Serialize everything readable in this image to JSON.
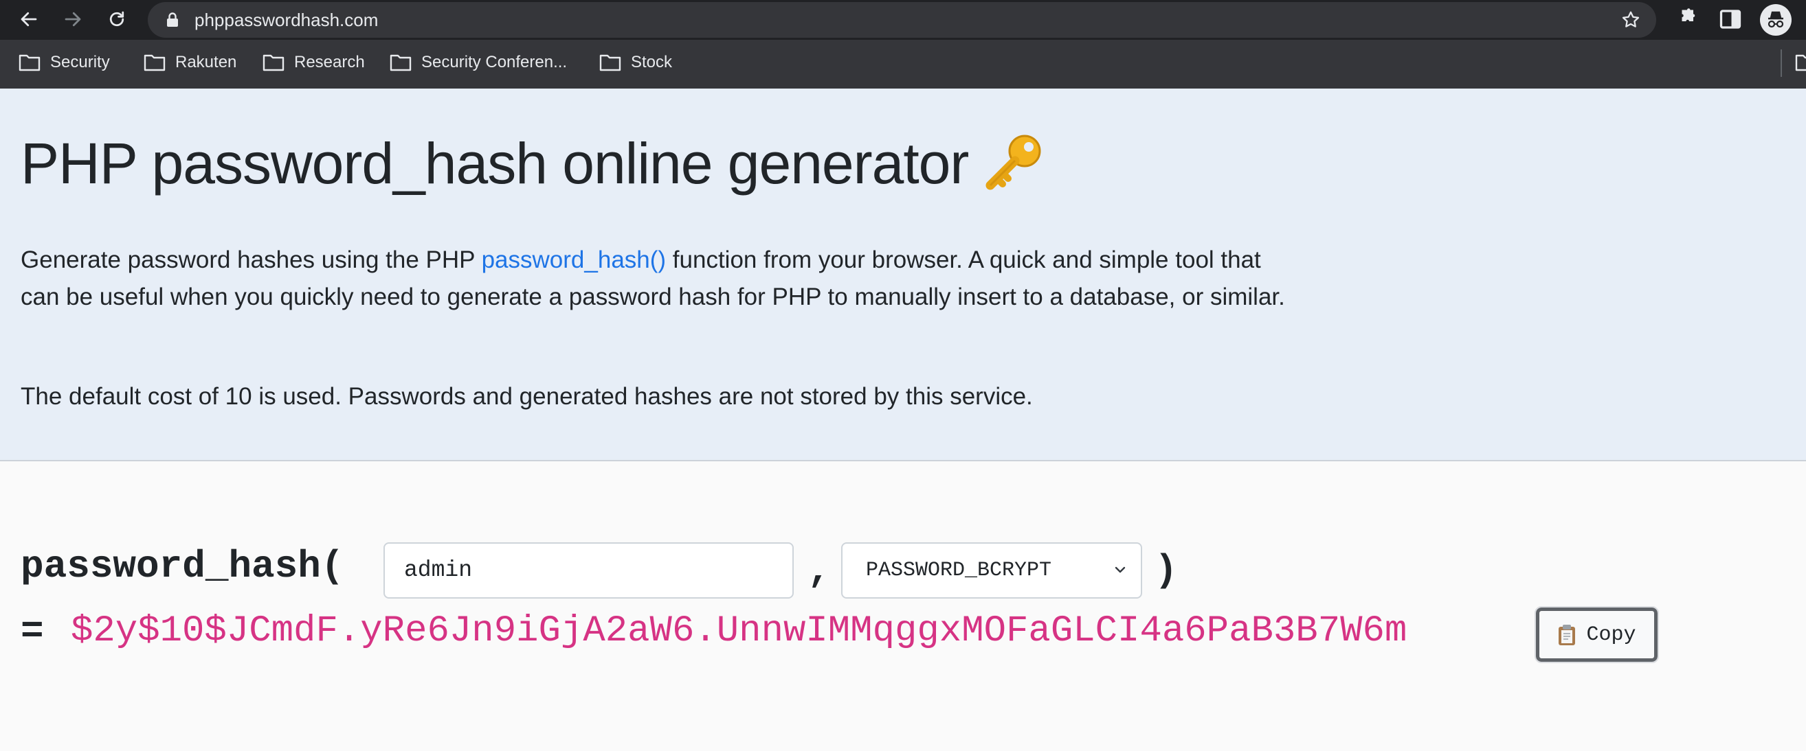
{
  "browser": {
    "url": "phppasswordhash.com",
    "bookmarks": [
      "Security",
      "Rakuten",
      "Research",
      "Security Conferen...",
      "Stock"
    ]
  },
  "page": {
    "title": "PHP password_hash online generator",
    "intro_before_link": "Generate password hashes using the PHP ",
    "intro_link": "password_hash()",
    "intro_after_link": " function from your browser. A quick and simple tool that can be useful when you quickly need to generate a password hash for PHP to manually insert to a database, or similar.",
    "note": "The default cost of 10 is used. Passwords and generated hashes are not stored by this service."
  },
  "generator": {
    "function_open": "password_hash(",
    "password_value": "admin",
    "comma": ",",
    "algorithm_selected": "PASSWORD_BCRYPT",
    "function_close": ")",
    "equals": "=",
    "hash": "$2y$10$JCmdF.yRe6Jn9iGjA2aW6.UnnwIMMqggxMOFaGLCI4a6PaB3B7W6m",
    "copy_label": "Copy"
  },
  "colors": {
    "hero_bg": "#e7eef7",
    "link": "#1e74e6",
    "hash": "#d63384"
  }
}
